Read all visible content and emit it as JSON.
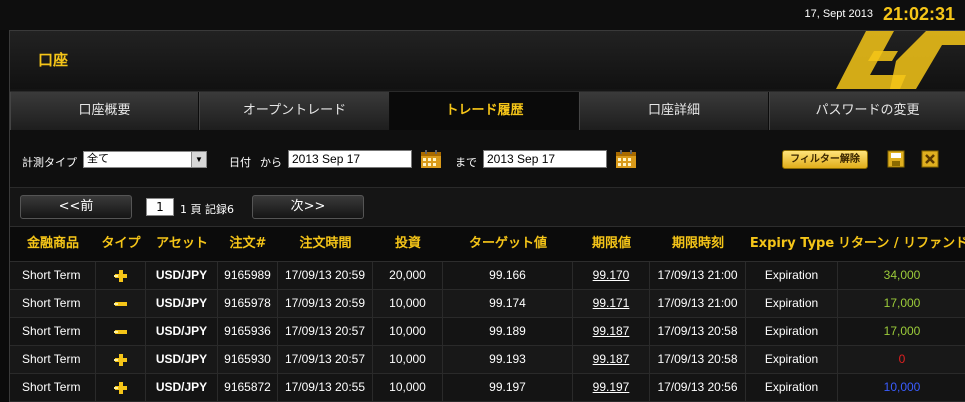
{
  "topbar": {
    "date": "17, Sept 2013",
    "clock": "21:02:31"
  },
  "page": {
    "title": "口座"
  },
  "tabs": [
    {
      "label": "口座概要",
      "active": false
    },
    {
      "label": "オープントレード",
      "active": false
    },
    {
      "label": "トレード履歴",
      "active": true
    },
    {
      "label": "口座詳細",
      "active": false
    },
    {
      "label": "パスワードの変更",
      "active": false
    }
  ],
  "filters": {
    "type_label": "計測タイプ",
    "type_value": "全て",
    "date_label": "日付",
    "from_label": "から",
    "from_value": "2013 Sep 17",
    "to_label": "まで",
    "to_value": "2013 Sep 17",
    "filter_button": "フィルター解除"
  },
  "pager": {
    "prev": "<<前",
    "page": "1",
    "info": "1 頁 記録6",
    "next": "次>>"
  },
  "colors": {
    "accent": "#f5c518",
    "green": "#9ccc3a",
    "red": "#e02020",
    "blue": "#3a5cff"
  },
  "table": {
    "headers": [
      "金融商品",
      "タイプ",
      "アセット",
      "注文#",
      "注文時間",
      "投資",
      "ターゲット値",
      "期限値",
      "期限時刻",
      "Expiry Type",
      "リターン / リファンド"
    ],
    "rows": [
      {
        "instrument": "Short Term",
        "type_icon": "call-arrow-icon",
        "asset": "USD/JPY",
        "order": "9165989",
        "time": "17/09/13 20:59",
        "investment": "20,000",
        "target": "99.166",
        "expiry_value": "99.170",
        "expiry_time": "17/09/13 21:00",
        "expiry_type": "Expiration",
        "return": "34,000",
        "return_color": "green"
      },
      {
        "instrument": "Short Term",
        "type_icon": "put-arrow-icon",
        "asset": "USD/JPY",
        "order": "9165978",
        "time": "17/09/13 20:59",
        "investment": "10,000",
        "target": "99.174",
        "expiry_value": "99.171",
        "expiry_time": "17/09/13 21:00",
        "expiry_type": "Expiration",
        "return": "17,000",
        "return_color": "green"
      },
      {
        "instrument": "Short Term",
        "type_icon": "put-arrow-icon",
        "asset": "USD/JPY",
        "order": "9165936",
        "time": "17/09/13 20:57",
        "investment": "10,000",
        "target": "99.189",
        "expiry_value": "99.187",
        "expiry_time": "17/09/13 20:58",
        "expiry_type": "Expiration",
        "return": "17,000",
        "return_color": "green"
      },
      {
        "instrument": "Short Term",
        "type_icon": "call-arrow-icon",
        "asset": "USD/JPY",
        "order": "9165930",
        "time": "17/09/13 20:57",
        "investment": "10,000",
        "target": "99.193",
        "expiry_value": "99.187",
        "expiry_time": "17/09/13 20:58",
        "expiry_type": "Expiration",
        "return": "0",
        "return_color": "red"
      },
      {
        "instrument": "Short Term",
        "type_icon": "call-arrow-icon",
        "asset": "USD/JPY",
        "order": "9165872",
        "time": "17/09/13 20:55",
        "investment": "10,000",
        "target": "99.197",
        "expiry_value": "99.197",
        "expiry_time": "17/09/13 20:56",
        "expiry_type": "Expiration",
        "return": "10,000",
        "return_color": "blue"
      }
    ]
  }
}
